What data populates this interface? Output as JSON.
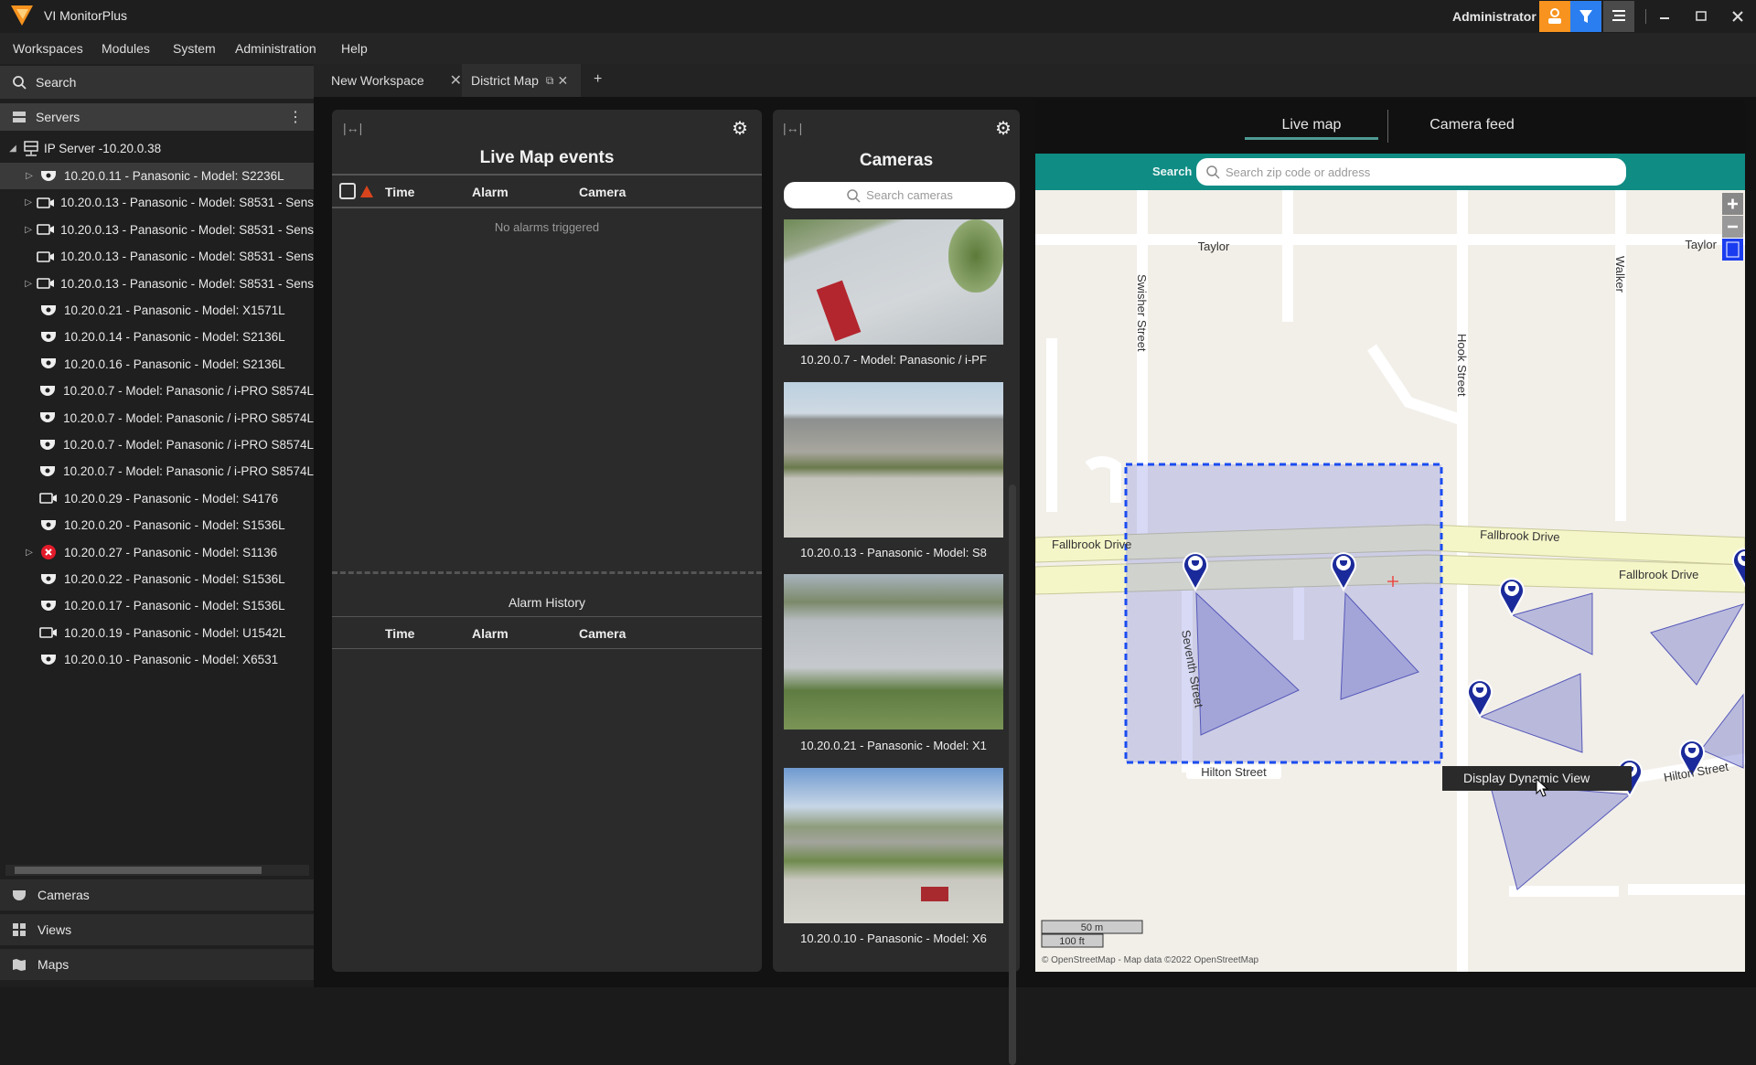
{
  "app": {
    "title": "VI MonitorPlus",
    "user": "Administrator",
    "brand_color": "#f7931e"
  },
  "menu": [
    "Workspaces",
    "Modules",
    "System",
    "Administration",
    "Help"
  ],
  "sidebar": {
    "search_label": "Search",
    "servers_label": "Servers",
    "server": "IP Server -10.20.0.38",
    "items": [
      {
        "label": "10.20.0.11 - Panasonic - Model: S2236L",
        "icon": "dome-camera",
        "expander": true,
        "selected": true
      },
      {
        "label": "10.20.0.13 - Panasonic - Model: S8531 - Sens",
        "icon": "box-camera",
        "expander": true
      },
      {
        "label": "10.20.0.13 - Panasonic - Model: S8531 - Sens",
        "icon": "box-camera",
        "expander": true
      },
      {
        "label": "10.20.0.13 - Panasonic - Model: S8531 - Sens",
        "icon": "box-camera",
        "expander": false
      },
      {
        "label": "10.20.0.13 - Panasonic - Model: S8531 - Sens",
        "icon": "box-camera",
        "expander": true
      },
      {
        "label": "10.20.0.21 - Panasonic - Model: X1571L",
        "icon": "dome-camera",
        "expander": false
      },
      {
        "label": "10.20.0.14 - Panasonic - Model: S2136L",
        "icon": "dome-camera",
        "expander": false
      },
      {
        "label": "10.20.0.16 - Panasonic - Model: S2136L",
        "icon": "dome-camera",
        "expander": false
      },
      {
        "label": "10.20.0.7 - Model: Panasonic / i-PRO S8574L",
        "icon": "dome-camera",
        "expander": false
      },
      {
        "label": "10.20.0.7 - Model: Panasonic / i-PRO S8574L",
        "icon": "dome-camera",
        "expander": false
      },
      {
        "label": "10.20.0.7 - Model: Panasonic / i-PRO S8574L",
        "icon": "dome-camera",
        "expander": false
      },
      {
        "label": "10.20.0.7 - Model: Panasonic / i-PRO S8574L",
        "icon": "dome-camera",
        "expander": false
      },
      {
        "label": "10.20.0.29 - Panasonic - Model: S4176",
        "icon": "box-camera",
        "expander": false
      },
      {
        "label": "10.20.0.20 - Panasonic - Model: S1536L",
        "icon": "dome-camera",
        "expander": false
      },
      {
        "label": "10.20.0.27 - Panasonic - Model: S1136",
        "icon": "error",
        "expander": true
      },
      {
        "label": "10.20.0.22 - Panasonic - Model: S1536L",
        "icon": "dome-camera",
        "expander": false
      },
      {
        "label": "10.20.0.17 - Panasonic - Model: S1536L",
        "icon": "dome-camera",
        "expander": false
      },
      {
        "label": "10.20.0.19 - Panasonic - Model: U1542L",
        "icon": "box-camera",
        "expander": false
      },
      {
        "label": "10.20.0.10 - Panasonic - Model: X6531",
        "icon": "dome-camera",
        "expander": false
      }
    ],
    "bottom": [
      {
        "label": "Cameras",
        "icon": "camera-icon"
      },
      {
        "label": "Views",
        "icon": "grid-icon"
      },
      {
        "label": "Maps",
        "icon": "map-icon"
      }
    ]
  },
  "tabs": [
    {
      "label": "New Workspace"
    },
    {
      "label": "District Map"
    }
  ],
  "events": {
    "title": "Live Map events",
    "cols": [
      "Time",
      "Alarm",
      "Camera"
    ],
    "empty": "No alarms triggered",
    "history_title": "Alarm History",
    "history_cols": [
      "Time",
      "Alarm",
      "Camera"
    ]
  },
  "cameras": {
    "title": "Cameras",
    "search_placeholder": "Search cameras",
    "items": [
      {
        "label": "10.20.0.7 - Model: Panasonic / i-PF"
      },
      {
        "label": "10.20.0.13 - Panasonic - Model: S8"
      },
      {
        "label": "10.20.0.21 - Panasonic - Model: X1"
      },
      {
        "label": "10.20.0.10 - Panasonic - Model: X6"
      }
    ]
  },
  "map": {
    "tabs": [
      "Live map",
      "Camera feed"
    ],
    "active_tab": "Live map",
    "search_label": "Search",
    "search_placeholder": "Search zip code or address",
    "streets": {
      "taylor": "Taylor",
      "taylor2": "Taylor",
      "swisher": "Swisher Street",
      "hook": "Hook Street",
      "walker": "Walker",
      "fallbrook1": "Fallbrook Drive",
      "fallbrook2": "Fallbrook Drive",
      "fallbrook3": "Fallbrook Drive",
      "seventh": "Seventh Street",
      "hilton": "Hilton Street",
      "hilton2": "Hilton Street"
    },
    "tooltip": "Display Dynamic View",
    "scale_m": "50 m",
    "scale_ft": "100 ft",
    "attribution": "© OpenStreetMap - Map data ©2022 OpenStreetMap",
    "accent": "#0f8c84",
    "fov_color": "#8d8fd6"
  }
}
